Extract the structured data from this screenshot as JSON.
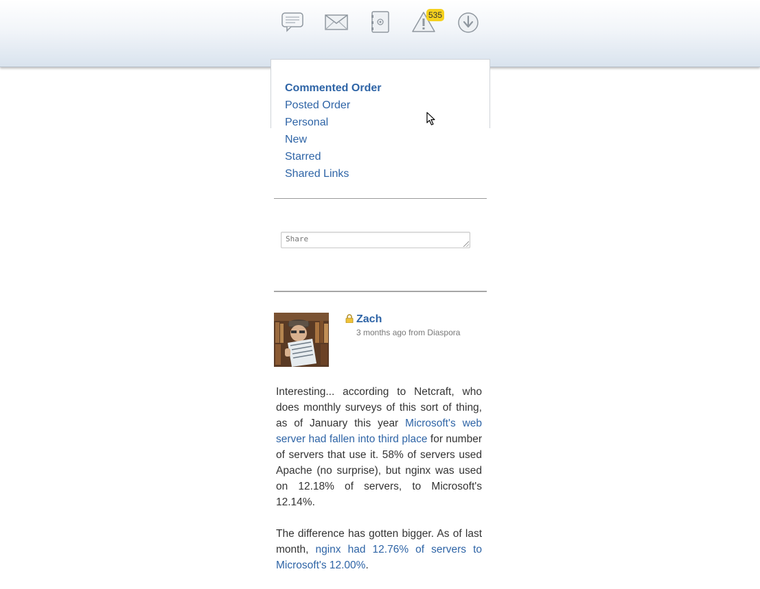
{
  "header": {
    "icons": [
      "comments-icon",
      "mail-icon",
      "contacts-icon",
      "notifications-icon",
      "download-icon"
    ],
    "notification_count": "535"
  },
  "stream_menu": {
    "items": [
      "Commented Order",
      "Posted Order",
      "Personal",
      "New",
      "Starred",
      "Shared Links"
    ],
    "active": "Commented Order"
  },
  "publisher": {
    "placeholder": "Share"
  },
  "post": {
    "author": "Zach",
    "time": "3 months ago",
    "from_word": "from",
    "source": "Diaspora",
    "p1_a": "Interesting... according to Netcraft, who does monthly surveys of this sort of thing, as of January this year ",
    "p1_link": "Microsoft's web server had fallen into third place",
    "p1_b": " for number of servers that use it. 58% of servers used Apache (no surprise), but nginx was used on 12.18% of servers, to Microsoft's 12.14%.",
    "p2_a": "The difference has gotten bigger. As of last month, ",
    "p2_link": "nginx had 12.76% of servers to Microsoft's 12.00%",
    "p2_b": "."
  },
  "colors": {
    "link": "#2e64a6",
    "badge": "#f5d11d"
  }
}
